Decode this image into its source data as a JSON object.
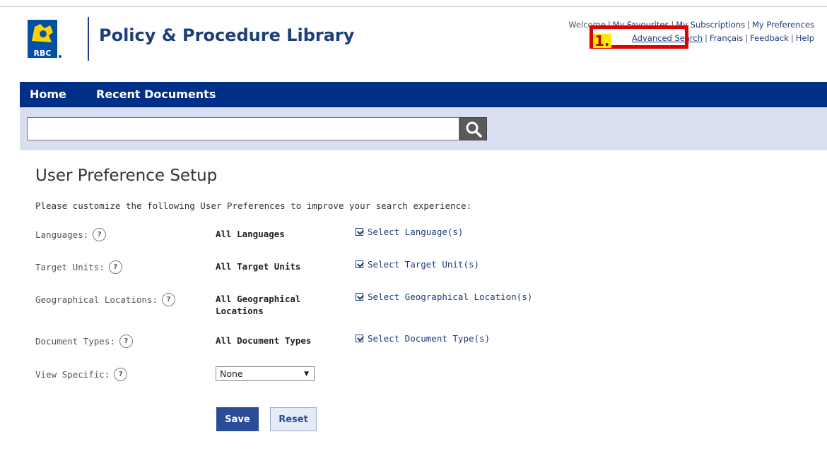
{
  "header": {
    "site_title": "Policy & Procedure Library",
    "logo_text": "RBC",
    "util_row1": {
      "welcome": "Welcome",
      "my_favourites": "My Favourites",
      "my_subscriptions": "My Subscriptions",
      "my_preferences": "My Preferences"
    },
    "util_row2": {
      "advanced_search": "Advanced Search",
      "francais": "Français",
      "feedback": "Feedback",
      "help": "Help"
    },
    "annotation_number": "1."
  },
  "nav": {
    "home": "Home",
    "recent_documents": "Recent Documents"
  },
  "search": {
    "value": "",
    "placeholder": ""
  },
  "main": {
    "title": "User Preference Setup",
    "intro": "Please customize the following User Preferences to improve your search experience:",
    "preferences": [
      {
        "label": "Languages:",
        "value": "All Languages",
        "link": "Select Language(s)"
      },
      {
        "label": "Target Units:",
        "value": "All Target Units",
        "link": "Select Target Unit(s)"
      },
      {
        "label": "Geographical Locations:",
        "value": "All Geographical Locations",
        "link": "Select Geographical Location(s)"
      },
      {
        "label": "Document Types:",
        "value": "All Document Types",
        "link": "Select Document Type(s)"
      }
    ],
    "view_specific": {
      "label": "View Specific:",
      "selected": "None"
    },
    "help_glyph": "?",
    "save_label": "Save",
    "reset_label": "Reset"
  },
  "colors": {
    "nav_bg": "#002f87",
    "search_band_bg": "#d9dff0",
    "title_blue": "#1b3f7a",
    "highlight_red": "#e00000",
    "highlight_yellow": "#ffeb00"
  }
}
